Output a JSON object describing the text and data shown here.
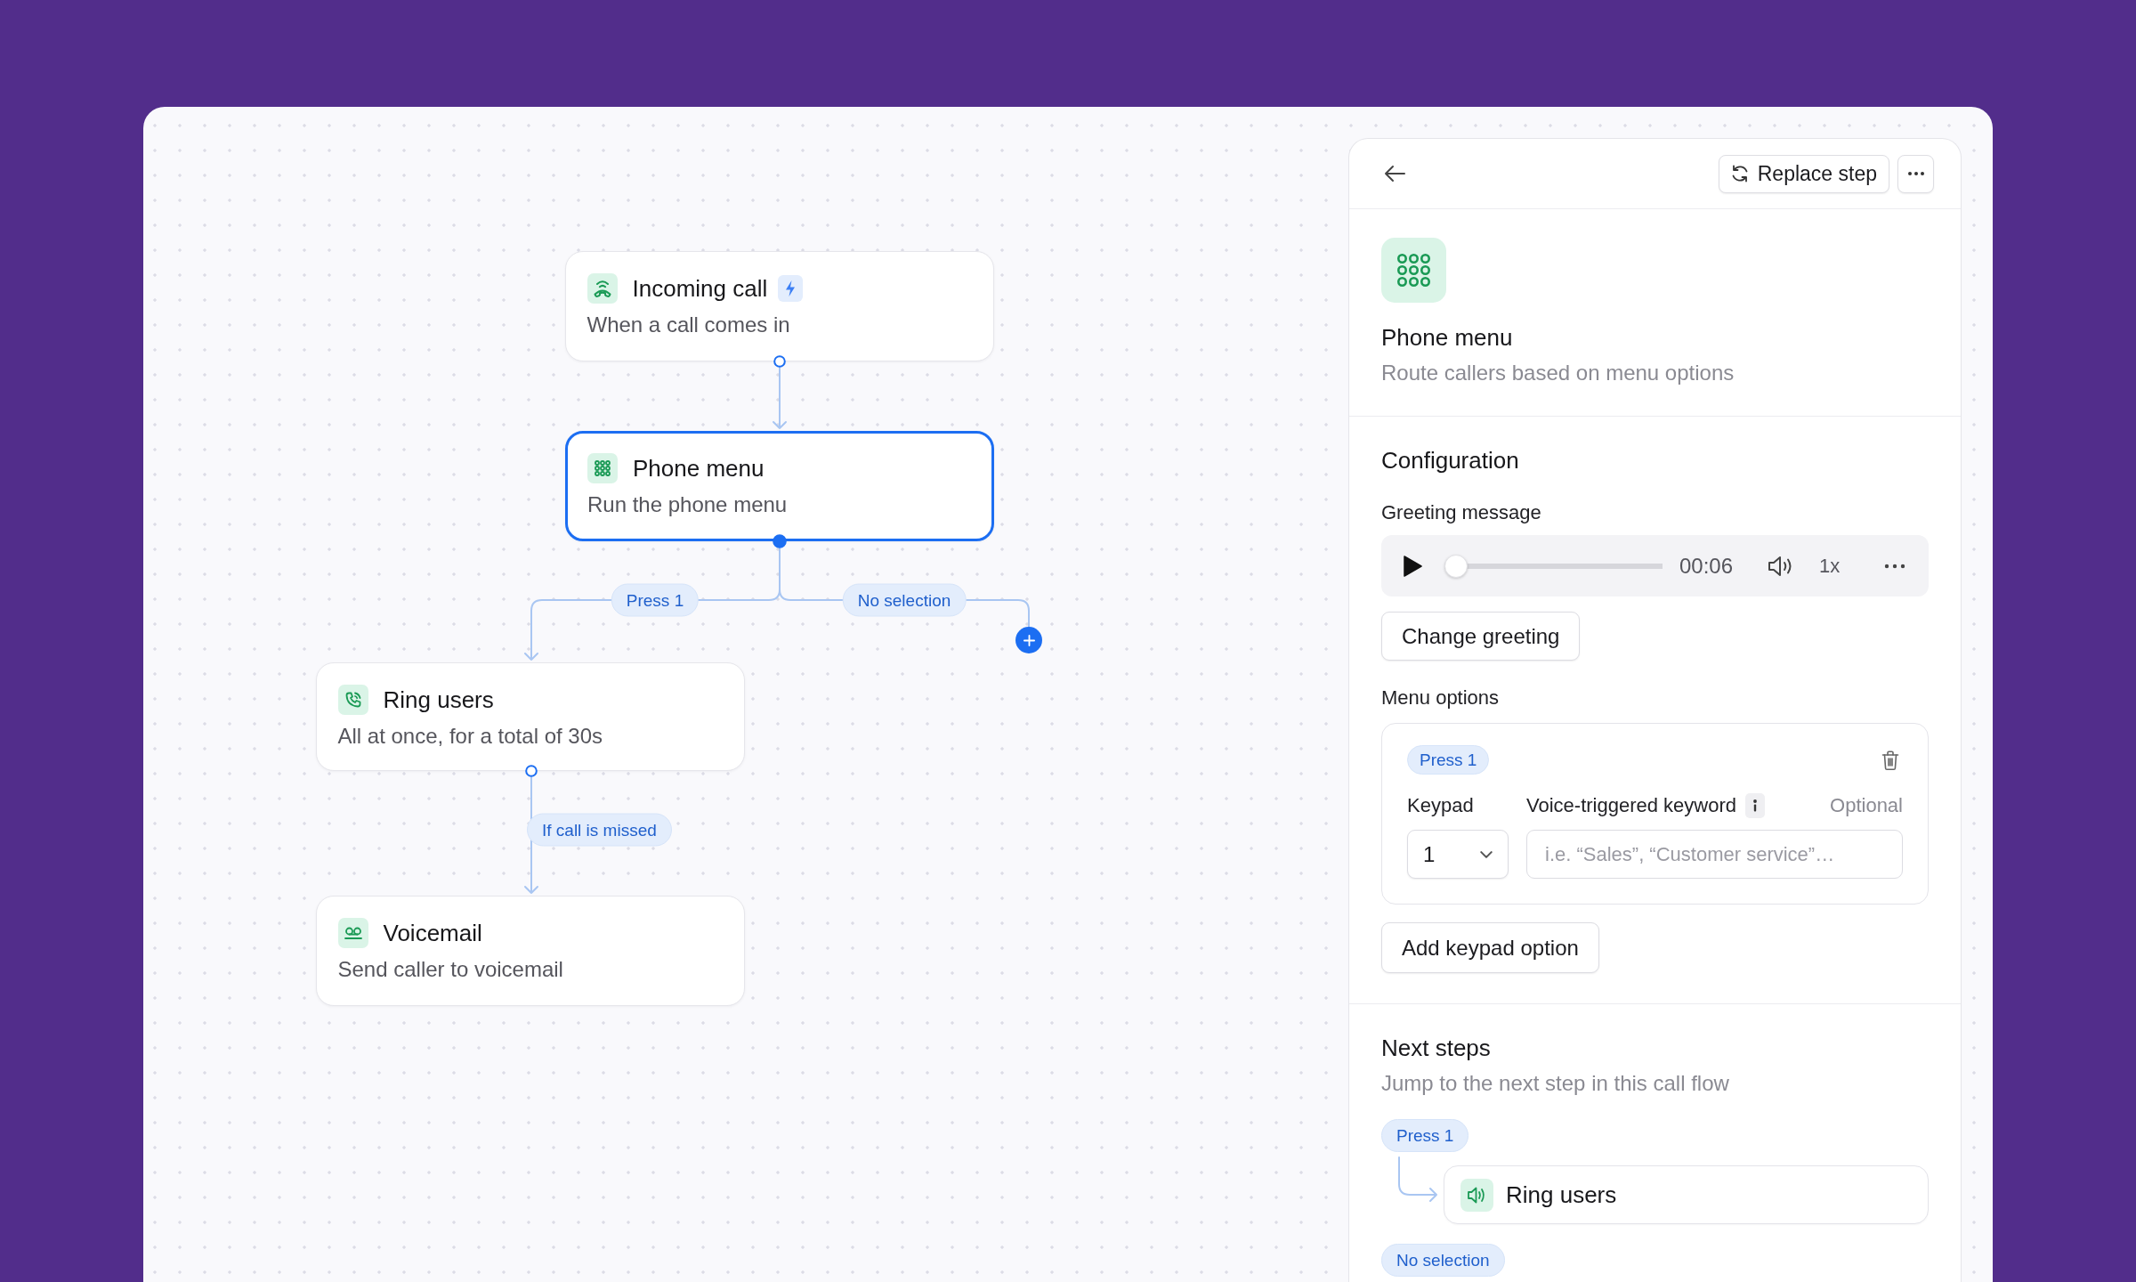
{
  "canvas": {
    "nodes": [
      {
        "kind": "trigger",
        "title": "Incoming call",
        "subtitle": "When a call comes in",
        "selected": false
      },
      {
        "kind": "menu",
        "title": "Phone menu",
        "subtitle": "Run the phone menu",
        "selected": true
      },
      {
        "kind": "ring",
        "title": "Ring users",
        "subtitle": "All at once, for a total of 30s",
        "selected": false
      },
      {
        "kind": "voicemail",
        "title": "Voicemail",
        "subtitle": "Send caller to voicemail",
        "selected": false
      }
    ],
    "edges": [
      {
        "label": "Press 1"
      },
      {
        "label": "No selection"
      },
      {
        "label": "If call is missed"
      }
    ]
  },
  "panel": {
    "replace_label": "Replace step",
    "step": {
      "kind": "menu",
      "title": "Phone menu",
      "description": "Route callers based on menu options"
    },
    "configuration": {
      "heading": "Configuration",
      "greeting_label": "Greeting message",
      "player": {
        "level": 0,
        "time": "00:06",
        "speed": "1x"
      },
      "change_label": "Change greeting",
      "options_label": "Menu options",
      "options": [
        {
          "tag": "Press 1",
          "keypad_label": "Keypad",
          "keypad_value": "1",
          "keyword_label": "Voice-triggered keyword",
          "keyword_hint": "Optional",
          "keyword_placeholder": "i.e. “Sales”, “Customer service”…"
        }
      ],
      "add_label": "Add keypad option"
    },
    "next_steps": {
      "heading": "Next steps",
      "description": "Jump to the next step in this call flow",
      "items": [
        {
          "tag": "Press 1",
          "target": "Ring users"
        },
        {
          "tag": "No selection"
        }
      ]
    }
  }
}
